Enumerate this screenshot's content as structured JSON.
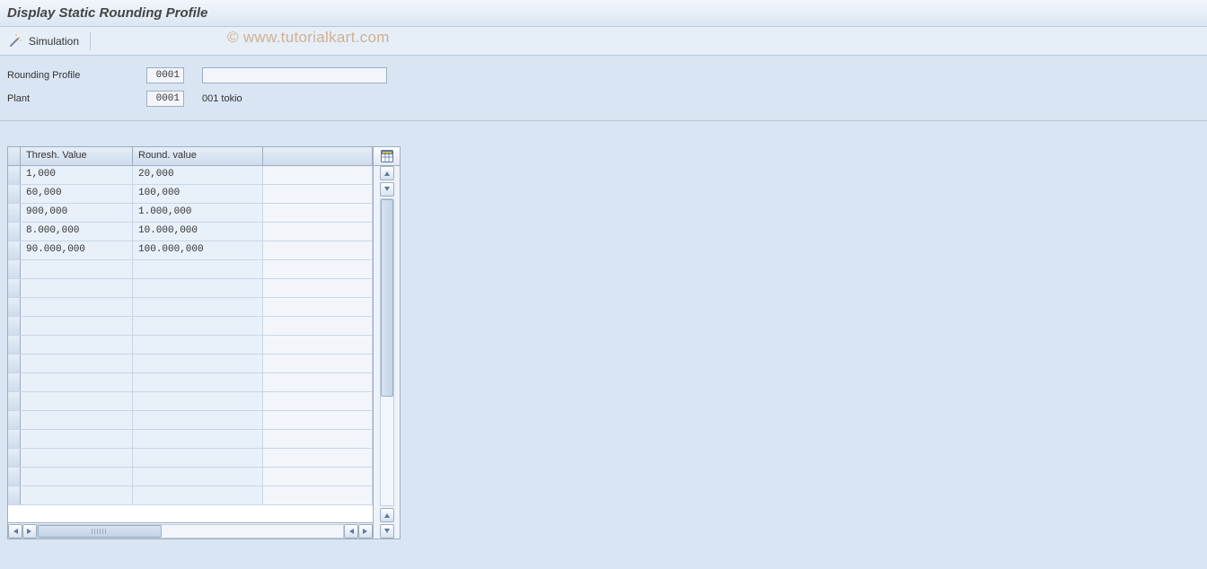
{
  "header": {
    "title": "Display Static Rounding Profile"
  },
  "toolbar": {
    "simulation_label": "Simulation"
  },
  "form": {
    "rounding_profile_label": "Rounding Profile",
    "rounding_profile_value": "0001",
    "rounding_profile_desc": "",
    "plant_label": "Plant",
    "plant_value": "0001",
    "plant_desc": "001 tokio"
  },
  "table": {
    "columns": {
      "thresh": "Thresh. Value",
      "round": "Round. value"
    },
    "rows": [
      {
        "thresh": "1,000",
        "round": "20,000"
      },
      {
        "thresh": "60,000",
        "round": "100,000"
      },
      {
        "thresh": "900,000",
        "round": "1.000,000"
      },
      {
        "thresh": "8.000,000",
        "round": "10.000,000"
      },
      {
        "thresh": "90.000,000",
        "round": "100.000,000"
      },
      {
        "thresh": "",
        "round": ""
      },
      {
        "thresh": "",
        "round": ""
      },
      {
        "thresh": "",
        "round": ""
      },
      {
        "thresh": "",
        "round": ""
      },
      {
        "thresh": "",
        "round": ""
      },
      {
        "thresh": "",
        "round": ""
      },
      {
        "thresh": "",
        "round": ""
      },
      {
        "thresh": "",
        "round": ""
      },
      {
        "thresh": "",
        "round": ""
      },
      {
        "thresh": "",
        "round": ""
      },
      {
        "thresh": "",
        "round": ""
      },
      {
        "thresh": "",
        "round": ""
      },
      {
        "thresh": "",
        "round": ""
      }
    ]
  },
  "watermark": "© www.tutorialkart.com"
}
